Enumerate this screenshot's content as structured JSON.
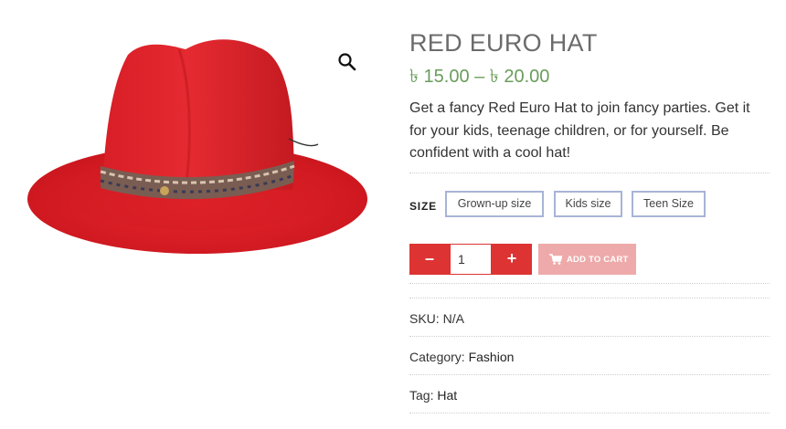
{
  "product": {
    "title": "RED EURO HAT",
    "price": "৳ 15.00 – ৳ 20.00",
    "description": "Get a fancy Red Euro Hat to join fancy parties. Get it for your kids, teenage children, or for yourself. Be confident with a cool hat!"
  },
  "zoom": {
    "icon": "magnifier-icon"
  },
  "size": {
    "label": "SIZE",
    "options": [
      "Grown-up size",
      "Kids size",
      "Teen Size"
    ]
  },
  "quantity": {
    "minus": "–",
    "plus": "+",
    "value": "1"
  },
  "cart": {
    "label": "ADD TO CART",
    "icon": "cart-icon"
  },
  "meta": {
    "sku_label": "SKU: ",
    "sku_value": "N/A",
    "category_label": "Category: ",
    "category_value": "Fashion",
    "tag_label": "Tag: ",
    "tag_value": "Hat"
  },
  "colors": {
    "hat": "#e0232b",
    "price": "#6a9d5b",
    "button": "#dd3333",
    "cart_button": "#eeaaaa",
    "swatch_border": "#a8b4d6"
  }
}
